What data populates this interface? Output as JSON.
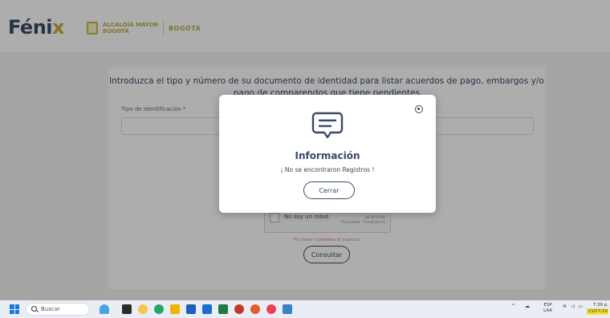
{
  "header": {
    "logo_main": "Féni",
    "logo_accent": "x",
    "gov_line1": "ALCALDÍA MAYOR",
    "gov_line2": "BOGOTÁ",
    "gov_brand": "BOGOTÁ"
  },
  "form": {
    "title": "Introduzca el tipo y número de su documento de identidad para listar acuerdos de pago, embargos y/o pago de comparendos que tiene pendientes",
    "id_type_label": "Tipo de identificación *",
    "captcha_label": "No soy un robot",
    "captcha_brand_1": "reCAPTCHA",
    "captcha_brand_2": "Privacidad - Condiciones",
    "captcha_warning": "Por favor complete el captcha",
    "consult_button": "Consultar"
  },
  "modal": {
    "title": "Información",
    "message": "¡ No se encontraron Registros !",
    "close_button": "Cerrar"
  },
  "taskbar": {
    "search_placeholder": "Buscar",
    "lang_1": "ESP",
    "lang_2": "LAA",
    "time": "7:39 p.",
    "date": "23/07/20"
  },
  "colors": {
    "primary": "#3a4a68",
    "accent": "#c9a93c",
    "warning": "#e0807a"
  }
}
